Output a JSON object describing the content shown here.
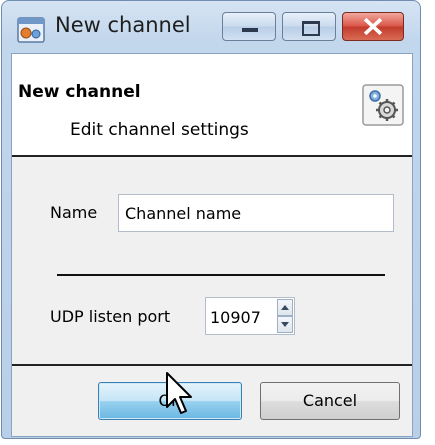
{
  "window": {
    "title": "New channel",
    "icon": "channel-app-icon",
    "controls": [
      "minimize-icon",
      "maximize-icon",
      "close-icon"
    ]
  },
  "header": {
    "title": "New channel",
    "subtitle": "Edit channel settings",
    "icon": "settings-gears-icon"
  },
  "form": {
    "name_label": "Name",
    "name_value": "Channel name",
    "port_label": "UDP listen port",
    "port_value": "10907"
  },
  "buttons": {
    "ok_label": "OK",
    "cancel_label": "Cancel"
  },
  "colors": {
    "frame": "#c2d6ec",
    "close_button": "#c23b2c",
    "ok_button": "#98d1ef"
  }
}
